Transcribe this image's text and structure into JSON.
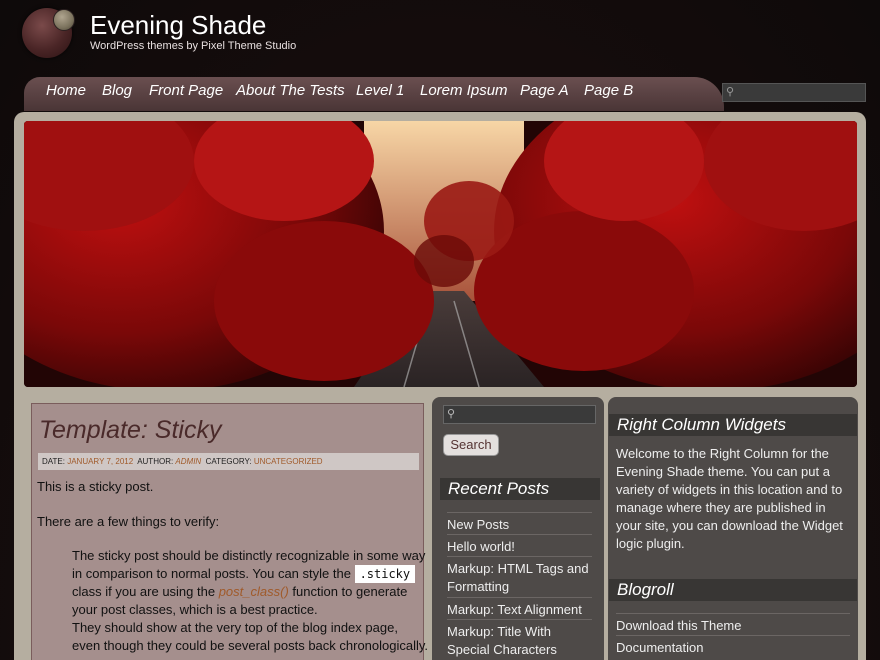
{
  "site": {
    "title": "Evening Shade",
    "description": "WordPress themes by Pixel Theme Studio"
  },
  "nav": {
    "items": [
      "Home",
      "Blog",
      "Front Page",
      "About The Tests",
      "Level 1",
      "Lorem Ipsum",
      "Page A",
      "Page B"
    ]
  },
  "search": {
    "icon": "magnifier-icon",
    "button_label": "Search"
  },
  "post": {
    "title": "Template: Sticky",
    "meta": {
      "date_label": "DATE:",
      "date": "JANUARY 7, 2012",
      "author_label": "AUTHOR:",
      "author": "ADMIN",
      "category_label": "CATEGORY:",
      "category": "UNCATEGORIZED"
    },
    "p1": "This is a sticky post.",
    "p2": "There are a few things to verify:",
    "item1_a": "The sticky post should be distinctly recognizable in some way",
    "item1_b": "in comparison to normal posts. You can style the",
    "item1_code": ".sticky",
    "item1_c": "class if you are using the",
    "item1_link": "post_class()",
    "item1_d": "function to generate",
    "item1_e": "your post classes, which is a best practice.",
    "item2_a": "They should show at the very top of the blog index page,",
    "item2_b": "even though they could be several posts back chronologically."
  },
  "middle": {
    "recent_title": "Recent Posts",
    "recent": [
      "New Posts",
      "Hello world!",
      "Markup: HTML Tags and Formatting",
      "Markup: Text Alignment",
      "Markup: Title With Special Characters"
    ]
  },
  "right": {
    "widgets_title": "Right Column Widgets",
    "widgets_text": "Welcome to the Right Column for the Evening Shade theme. You can put a variety of widgets in this location and to manage where they are published in your site, you can download the Widget logic plugin.",
    "blogroll_title": "Blogroll",
    "blogroll": [
      "Download this Theme",
      "Documentation"
    ]
  },
  "colors": {
    "accent_link": "#a05a2a",
    "post_bg": "#a58f8d",
    "sidebar_bg": "#4e4a48"
  }
}
